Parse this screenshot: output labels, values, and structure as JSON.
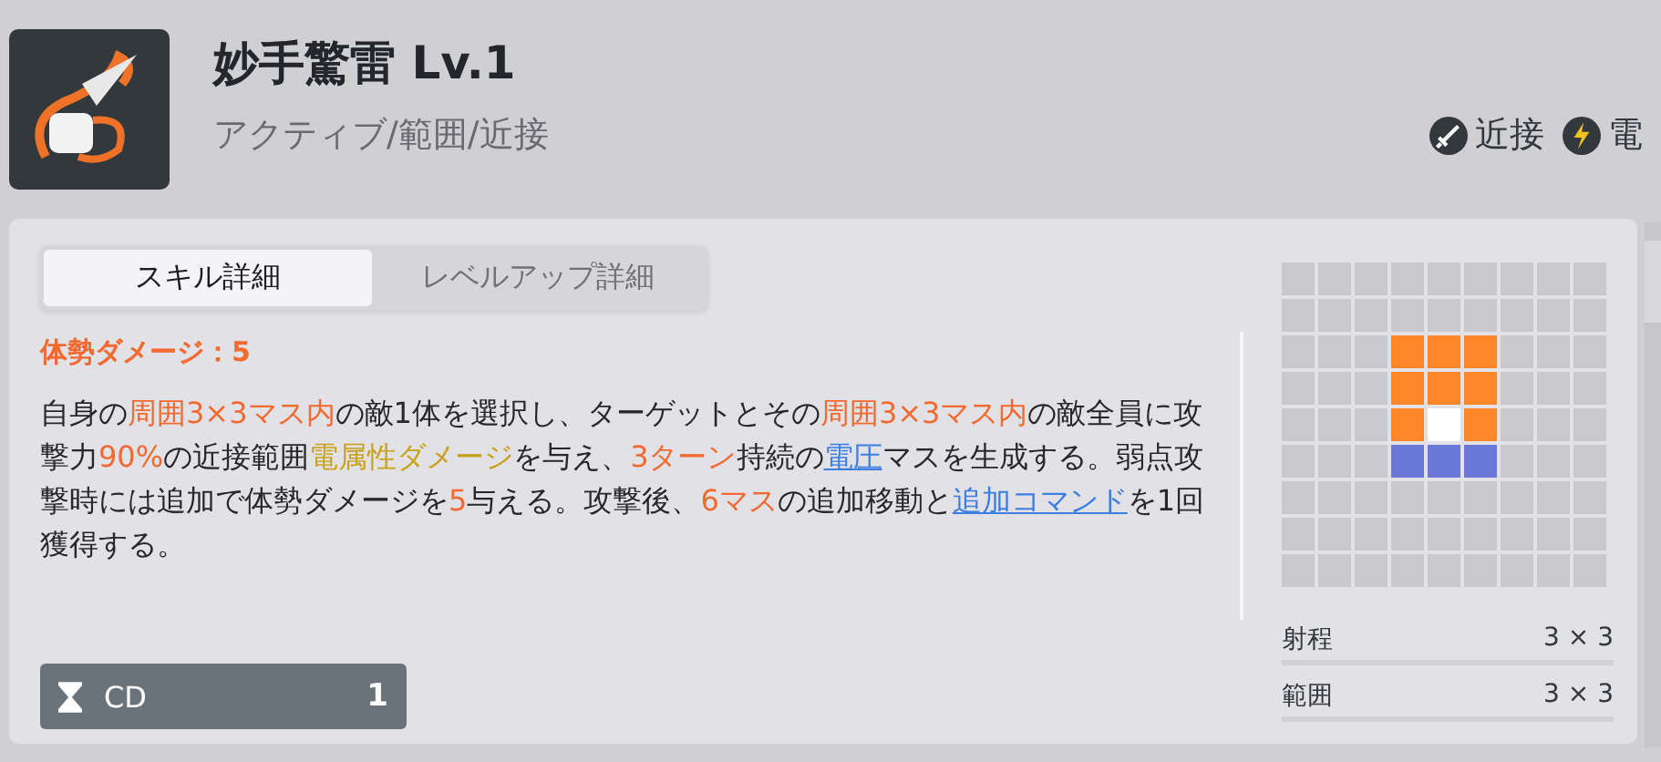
{
  "skill": {
    "name": "妙手驚雷 Lv.1",
    "categories": "アクティブ/範囲/近接"
  },
  "attributes": [
    {
      "kind": "melee",
      "label": "近接"
    },
    {
      "kind": "electric",
      "label": "電"
    }
  ],
  "tabs": [
    {
      "label": "スキル詳細",
      "selected": true
    },
    {
      "label": "レベルアップ詳細",
      "selected": false
    }
  ],
  "stance_damage": "体勢ダメージ：5",
  "description": [
    {
      "kind": "plain",
      "text": "自身の"
    },
    {
      "kind": "highlight",
      "text": "周囲3×3マス内"
    },
    {
      "kind": "plain",
      "text": "の敵1体を選択し、ターゲットとその"
    },
    {
      "kind": "highlight",
      "text": "周囲3×3マス内"
    },
    {
      "kind": "plain",
      "text": "の敵全員に攻撃力"
    },
    {
      "kind": "highlight",
      "text": "90%"
    },
    {
      "kind": "plain",
      "text": "の近接範囲"
    },
    {
      "kind": "element",
      "text": "電属性ダメージ"
    },
    {
      "kind": "plain",
      "text": "を与え、"
    },
    {
      "kind": "highlight",
      "text": "3ターン"
    },
    {
      "kind": "plain",
      "text": "持続の"
    },
    {
      "kind": "link",
      "text": "電圧"
    },
    {
      "kind": "plain",
      "text": "マスを生成する。弱点攻撃時には追加で体勢ダメージを"
    },
    {
      "kind": "highlight",
      "text": "5"
    },
    {
      "kind": "plain",
      "text": "与える。攻撃後、"
    },
    {
      "kind": "highlight",
      "text": "6マス"
    },
    {
      "kind": "plain",
      "text": "の追加移動と"
    },
    {
      "kind": "link",
      "text": "追加コマンド"
    },
    {
      "kind": "plain",
      "text": "を1回獲得する。"
    }
  ],
  "cooldown": {
    "label": "CD",
    "value": "1"
  },
  "range_grid": [
    [
      {
        "kind": "empty"
      },
      {
        "kind": "empty"
      },
      {
        "kind": "empty"
      },
      {
        "kind": "empty"
      },
      {
        "kind": "empty"
      },
      {
        "kind": "empty"
      },
      {
        "kind": "empty"
      },
      {
        "kind": "empty"
      },
      {
        "kind": "empty"
      }
    ],
    [
      {
        "kind": "empty"
      },
      {
        "kind": "empty"
      },
      {
        "kind": "empty"
      },
      {
        "kind": "empty"
      },
      {
        "kind": "empty"
      },
      {
        "kind": "empty"
      },
      {
        "kind": "empty"
      },
      {
        "kind": "empty"
      },
      {
        "kind": "empty"
      }
    ],
    [
      {
        "kind": "empty"
      },
      {
        "kind": "empty"
      },
      {
        "kind": "empty"
      },
      {
        "kind": "area"
      },
      {
        "kind": "area"
      },
      {
        "kind": "area"
      },
      {
        "kind": "empty"
      },
      {
        "kind": "empty"
      },
      {
        "kind": "empty"
      }
    ],
    [
      {
        "kind": "empty"
      },
      {
        "kind": "empty"
      },
      {
        "kind": "empty"
      },
      {
        "kind": "area"
      },
      {
        "kind": "area"
      },
      {
        "kind": "area"
      },
      {
        "kind": "empty"
      },
      {
        "kind": "empty"
      },
      {
        "kind": "empty"
      }
    ],
    [
      {
        "kind": "empty"
      },
      {
        "kind": "empty"
      },
      {
        "kind": "empty"
      },
      {
        "kind": "area"
      },
      {
        "kind": "self"
      },
      {
        "kind": "area"
      },
      {
        "kind": "empty"
      },
      {
        "kind": "empty"
      },
      {
        "kind": "empty"
      }
    ],
    [
      {
        "kind": "empty"
      },
      {
        "kind": "empty"
      },
      {
        "kind": "empty"
      },
      {
        "kind": "reach"
      },
      {
        "kind": "reach"
      },
      {
        "kind": "reach"
      },
      {
        "kind": "empty"
      },
      {
        "kind": "empty"
      },
      {
        "kind": "empty"
      }
    ],
    [
      {
        "kind": "empty"
      },
      {
        "kind": "empty"
      },
      {
        "kind": "empty"
      },
      {
        "kind": "empty"
      },
      {
        "kind": "empty"
      },
      {
        "kind": "empty"
      },
      {
        "kind": "empty"
      },
      {
        "kind": "empty"
      },
      {
        "kind": "empty"
      }
    ],
    [
      {
        "kind": "empty"
      },
      {
        "kind": "empty"
      },
      {
        "kind": "empty"
      },
      {
        "kind": "empty"
      },
      {
        "kind": "empty"
      },
      {
        "kind": "empty"
      },
      {
        "kind": "empty"
      },
      {
        "kind": "empty"
      },
      {
        "kind": "empty"
      }
    ],
    [
      {
        "kind": "empty"
      },
      {
        "kind": "empty"
      },
      {
        "kind": "empty"
      },
      {
        "kind": "empty"
      },
      {
        "kind": "empty"
      },
      {
        "kind": "empty"
      },
      {
        "kind": "empty"
      },
      {
        "kind": "empty"
      },
      {
        "kind": "empty"
      }
    ]
  ],
  "stats": [
    {
      "label": "射程",
      "value": "3 × 3"
    },
    {
      "label": "範囲",
      "value": "3 × 3"
    }
  ]
}
